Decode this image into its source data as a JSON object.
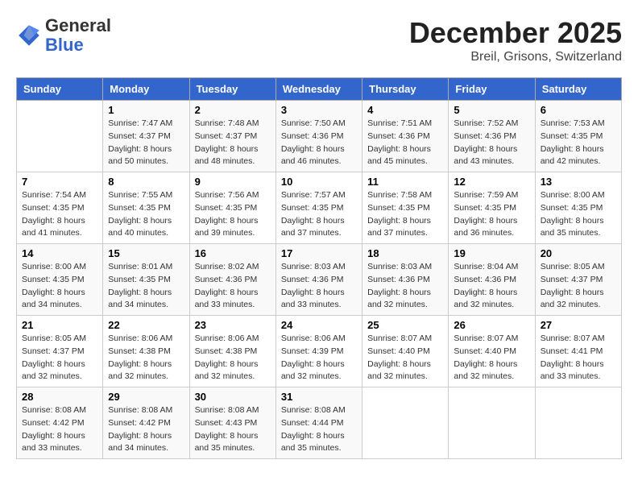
{
  "header": {
    "logo_line1": "General",
    "logo_line2": "Blue",
    "title": "December 2025",
    "subtitle": "Breil, Grisons, Switzerland"
  },
  "calendar": {
    "days_of_week": [
      "Sunday",
      "Monday",
      "Tuesday",
      "Wednesday",
      "Thursday",
      "Friday",
      "Saturday"
    ],
    "weeks": [
      [
        {
          "day": "",
          "info": ""
        },
        {
          "day": "1",
          "info": "Sunrise: 7:47 AM\nSunset: 4:37 PM\nDaylight: 8 hours\nand 50 minutes."
        },
        {
          "day": "2",
          "info": "Sunrise: 7:48 AM\nSunset: 4:37 PM\nDaylight: 8 hours\nand 48 minutes."
        },
        {
          "day": "3",
          "info": "Sunrise: 7:50 AM\nSunset: 4:36 PM\nDaylight: 8 hours\nand 46 minutes."
        },
        {
          "day": "4",
          "info": "Sunrise: 7:51 AM\nSunset: 4:36 PM\nDaylight: 8 hours\nand 45 minutes."
        },
        {
          "day": "5",
          "info": "Sunrise: 7:52 AM\nSunset: 4:36 PM\nDaylight: 8 hours\nand 43 minutes."
        },
        {
          "day": "6",
          "info": "Sunrise: 7:53 AM\nSunset: 4:35 PM\nDaylight: 8 hours\nand 42 minutes."
        }
      ],
      [
        {
          "day": "7",
          "info": "Sunrise: 7:54 AM\nSunset: 4:35 PM\nDaylight: 8 hours\nand 41 minutes."
        },
        {
          "day": "8",
          "info": "Sunrise: 7:55 AM\nSunset: 4:35 PM\nDaylight: 8 hours\nand 40 minutes."
        },
        {
          "day": "9",
          "info": "Sunrise: 7:56 AM\nSunset: 4:35 PM\nDaylight: 8 hours\nand 39 minutes."
        },
        {
          "day": "10",
          "info": "Sunrise: 7:57 AM\nSunset: 4:35 PM\nDaylight: 8 hours\nand 37 minutes."
        },
        {
          "day": "11",
          "info": "Sunrise: 7:58 AM\nSunset: 4:35 PM\nDaylight: 8 hours\nand 37 minutes."
        },
        {
          "day": "12",
          "info": "Sunrise: 7:59 AM\nSunset: 4:35 PM\nDaylight: 8 hours\nand 36 minutes."
        },
        {
          "day": "13",
          "info": "Sunrise: 8:00 AM\nSunset: 4:35 PM\nDaylight: 8 hours\nand 35 minutes."
        }
      ],
      [
        {
          "day": "14",
          "info": "Sunrise: 8:00 AM\nSunset: 4:35 PM\nDaylight: 8 hours\nand 34 minutes."
        },
        {
          "day": "15",
          "info": "Sunrise: 8:01 AM\nSunset: 4:35 PM\nDaylight: 8 hours\nand 34 minutes."
        },
        {
          "day": "16",
          "info": "Sunrise: 8:02 AM\nSunset: 4:36 PM\nDaylight: 8 hours\nand 33 minutes."
        },
        {
          "day": "17",
          "info": "Sunrise: 8:03 AM\nSunset: 4:36 PM\nDaylight: 8 hours\nand 33 minutes."
        },
        {
          "day": "18",
          "info": "Sunrise: 8:03 AM\nSunset: 4:36 PM\nDaylight: 8 hours\nand 32 minutes."
        },
        {
          "day": "19",
          "info": "Sunrise: 8:04 AM\nSunset: 4:36 PM\nDaylight: 8 hours\nand 32 minutes."
        },
        {
          "day": "20",
          "info": "Sunrise: 8:05 AM\nSunset: 4:37 PM\nDaylight: 8 hours\nand 32 minutes."
        }
      ],
      [
        {
          "day": "21",
          "info": "Sunrise: 8:05 AM\nSunset: 4:37 PM\nDaylight: 8 hours\nand 32 minutes."
        },
        {
          "day": "22",
          "info": "Sunrise: 8:06 AM\nSunset: 4:38 PM\nDaylight: 8 hours\nand 32 minutes."
        },
        {
          "day": "23",
          "info": "Sunrise: 8:06 AM\nSunset: 4:38 PM\nDaylight: 8 hours\nand 32 minutes."
        },
        {
          "day": "24",
          "info": "Sunrise: 8:06 AM\nSunset: 4:39 PM\nDaylight: 8 hours\nand 32 minutes."
        },
        {
          "day": "25",
          "info": "Sunrise: 8:07 AM\nSunset: 4:40 PM\nDaylight: 8 hours\nand 32 minutes."
        },
        {
          "day": "26",
          "info": "Sunrise: 8:07 AM\nSunset: 4:40 PM\nDaylight: 8 hours\nand 32 minutes."
        },
        {
          "day": "27",
          "info": "Sunrise: 8:07 AM\nSunset: 4:41 PM\nDaylight: 8 hours\nand 33 minutes."
        }
      ],
      [
        {
          "day": "28",
          "info": "Sunrise: 8:08 AM\nSunset: 4:42 PM\nDaylight: 8 hours\nand 33 minutes."
        },
        {
          "day": "29",
          "info": "Sunrise: 8:08 AM\nSunset: 4:42 PM\nDaylight: 8 hours\nand 34 minutes."
        },
        {
          "day": "30",
          "info": "Sunrise: 8:08 AM\nSunset: 4:43 PM\nDaylight: 8 hours\nand 35 minutes."
        },
        {
          "day": "31",
          "info": "Sunrise: 8:08 AM\nSunset: 4:44 PM\nDaylight: 8 hours\nand 35 minutes."
        },
        {
          "day": "",
          "info": ""
        },
        {
          "day": "",
          "info": ""
        },
        {
          "day": "",
          "info": ""
        }
      ]
    ]
  }
}
